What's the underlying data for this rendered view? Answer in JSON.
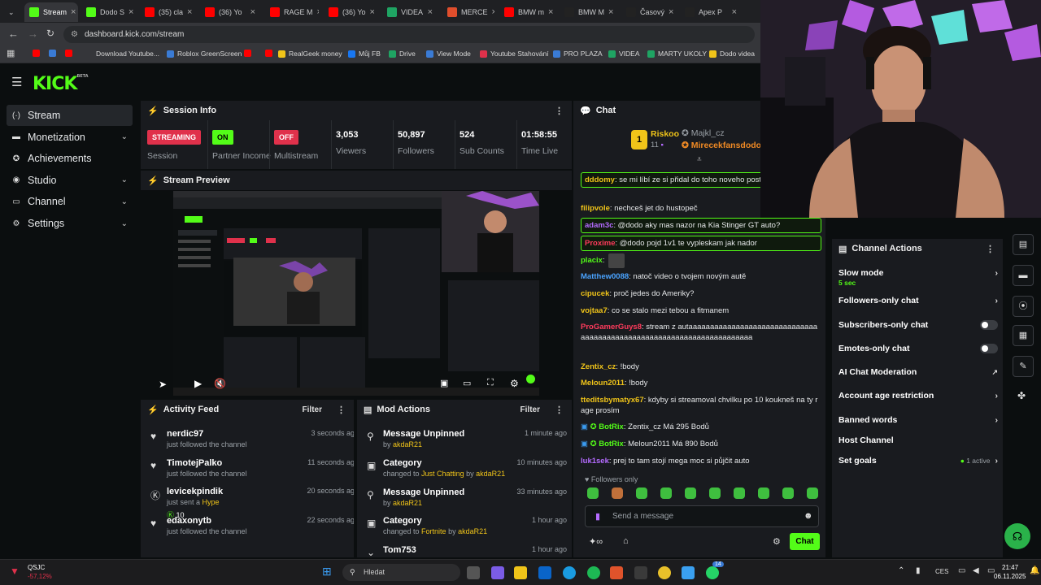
{
  "browser": {
    "tabs": [
      {
        "label": "Stream",
        "fav": "#53fc18",
        "active": true
      },
      {
        "label": "Dodo S",
        "fav": "#53fc18"
      },
      {
        "label": "(35) cla",
        "fav": "#ff0000"
      },
      {
        "label": "(36) Yo",
        "fav": "#ff0000"
      },
      {
        "label": "RAGE M",
        "fav": "#ff0000"
      },
      {
        "label": "(36) Yo",
        "fav": "#ff0000"
      },
      {
        "label": "VIDEA",
        "fav": "#1fa463"
      },
      {
        "label": "MERCE",
        "fav": "#e04e2c"
      },
      {
        "label": "BMW m",
        "fav": "#ff0000"
      },
      {
        "label": "BMW M",
        "fav": "#222222"
      },
      {
        "label": "Časový",
        "fav": "#222222"
      },
      {
        "label": "Apex P",
        "fav": "#222222"
      }
    ],
    "url": "dashboard.kick.com/stream",
    "bookmarks": [
      "Download Youtube...",
      "Roblox GreenScreen",
      "RealGeek money",
      "Můj FB",
      "Drive",
      "View Mode",
      "Youtube Stahování",
      "PRO PLAZA",
      "VIDEA",
      "MARTY UKOLY",
      "Dodo videa"
    ]
  },
  "brand": {
    "logo": "KICK",
    "beta": "BETA",
    "accent": "#53fc18"
  },
  "sidebar": {
    "items": [
      {
        "label": "Stream",
        "icon": "stream-icon"
      },
      {
        "label": "Monetization",
        "icon": "money-icon",
        "chevron": true
      },
      {
        "label": "Achievements",
        "icon": "trophy-icon"
      },
      {
        "label": "Studio",
        "icon": "studio-icon",
        "chevron": true
      },
      {
        "label": "Channel",
        "icon": "channel-icon",
        "chevron": true
      },
      {
        "label": "Settings",
        "icon": "gear-icon",
        "chevron": true
      }
    ]
  },
  "session": {
    "title": "Session Info",
    "stats": [
      {
        "badge": "STREAMING",
        "label": "Session"
      },
      {
        "badge": "ON",
        "label": "Partner Income"
      },
      {
        "badge": "OFF",
        "label": "Multistream"
      },
      {
        "value": "3,053",
        "label": "Viewers"
      },
      {
        "value": "50,897",
        "label": "Followers"
      },
      {
        "value": "524",
        "label": "Sub Counts"
      },
      {
        "value": "01:58:55",
        "label": "Time Live"
      }
    ]
  },
  "preview": {
    "title": "Stream Preview"
  },
  "activity": {
    "title": "Activity Feed",
    "filter": "Filter",
    "rows": [
      {
        "name": "nerdic97",
        "sub": "just followed the channel",
        "time": "3 seconds ago",
        "icon": "heart-icon"
      },
      {
        "name": "TimotejPalko",
        "sub": "just followed the channel",
        "time": "11 seconds ago",
        "icon": "heart-icon"
      },
      {
        "name": "levicekpindik",
        "sub_pre": "just sent a ",
        "sub_link": "Hype",
        "amount": "10",
        "time": "20 seconds ago",
        "icon": "kick-icon"
      },
      {
        "name": "edaxonytb",
        "sub": "just followed the channel",
        "time": "22 seconds ago",
        "icon": "heart-icon"
      }
    ]
  },
  "modactions": {
    "title": "Mod Actions",
    "filter": "Filter",
    "rows": [
      {
        "name": "Message Unpinned",
        "pre": "by ",
        "link": "akdaR21",
        "time": "1 minute ago",
        "icon": "unpin-icon"
      },
      {
        "name": "Category",
        "pre": "changed to ",
        "cat": "Just Chatting",
        "mid": " by ",
        "link": "akdaR21",
        "time": "10 minutes ago",
        "icon": "category-icon"
      },
      {
        "name": "Message Unpinned",
        "pre": "by ",
        "link": "akdaR21",
        "time": "33 minutes ago",
        "icon": "unpin-icon"
      },
      {
        "name": "Category",
        "pre": "changed to ",
        "cat": "Fortnite",
        "mid": " by ",
        "link": "akdaR21",
        "time": "1 hour ago",
        "icon": "category-icon"
      },
      {
        "name": "Tom753",
        "time": "1 hour ago",
        "icon": "chevron-icon"
      }
    ]
  },
  "chat": {
    "title": "Chat",
    "leader": {
      "rank": "1",
      "name": "Riskoo",
      "count": "11",
      "second": "Majkl_cz",
      "third": "Mirecekfansdodo"
    },
    "messages": [
      {
        "user": "dddomy",
        "color": "#f0c419",
        "text": "se mi líbí ze si přidal do toho noveho postu @dodo",
        "hl": true
      },
      {
        "user": "filipvole",
        "color": "#f0c419",
        "text": "nechceš jet do hustopeč"
      },
      {
        "user": "adam3c",
        "color": "#b46bff",
        "text": "@dodo aky mas nazor na Kia Stinger GT auto?",
        "hl": true
      },
      {
        "user": "Proxime",
        "color": "#ff3b5c",
        "text": "@dodo pojd 1v1 te vypleskam jak nador",
        "hl": true
      },
      {
        "user": "placix",
        "color": "#53fc18",
        "text": ""
      },
      {
        "user": "Matthew0088",
        "color": "#4aa3ff",
        "text": "natoč video o tvojem novým autě"
      },
      {
        "user": "cipucek",
        "color": "#f0c419",
        "text": "proč jedes do Ameriky?"
      },
      {
        "user": "vojtaa7",
        "color": "#f0c419",
        "text": "co se stalo mezi tebou a fitmanem"
      },
      {
        "user": "ProGamerGuys8",
        "color": "#ff3b5c",
        "text": "stream z autaaaaaaaaaaaaaaaaaaaaaaaaaaaaaaaaaaaaaaaaaaaaaaaaaaaaaaaaaaaaaaaaaaaaaa"
      },
      {
        "user": "Zentix_cz",
        "color": "#f0c419",
        "text": "!body"
      },
      {
        "user": "Meloun2011",
        "color": "#f0c419",
        "text": "!body"
      },
      {
        "user": "tteditsbymatyx67",
        "color": "#f0c419",
        "text": "kdyby si streamoval chvilku po 10 koukneš na ty rage prosím"
      },
      {
        "user": "BotRix",
        "color": "#53fc18",
        "text": "Zentix_cz Má 295 Bodů",
        "bot": true
      },
      {
        "user": "BotRix",
        "color": "#53fc18",
        "text": "Meloun2011 Má 890 Bodů",
        "bot": true
      },
      {
        "user": "luk1sek",
        "color": "#b46bff",
        "text": "prej to tam stojí mega moc si půjčit auto"
      }
    ],
    "followers_only": "Followers only",
    "placeholder": "Send a message",
    "send": "Chat"
  },
  "channel_actions": {
    "title": "Channel Actions",
    "items": [
      {
        "label": "Slow mode",
        "sub": "5 sec",
        "right": "chevron"
      },
      {
        "label": "Followers-only chat",
        "right": "chevron"
      },
      {
        "label": "Subscribers-only chat",
        "right": "toggle"
      },
      {
        "label": "Emotes-only chat",
        "right": "toggle"
      },
      {
        "label": "AI Chat Moderation",
        "right": "external"
      },
      {
        "label": "Account age restriction",
        "right": "chevron"
      },
      {
        "label": "Banned words",
        "right": "chevron"
      },
      {
        "label": "Host Channel",
        "right": ""
      },
      {
        "label": "Set goals",
        "extra": "1 active",
        "right": "chevron"
      }
    ]
  },
  "taskbar": {
    "weather": "QSJC",
    "weather_sub": "-57,12%",
    "search": "Hledat",
    "lang": "CES",
    "time": "21:47",
    "date": "06.11.2025",
    "badge": "14"
  }
}
